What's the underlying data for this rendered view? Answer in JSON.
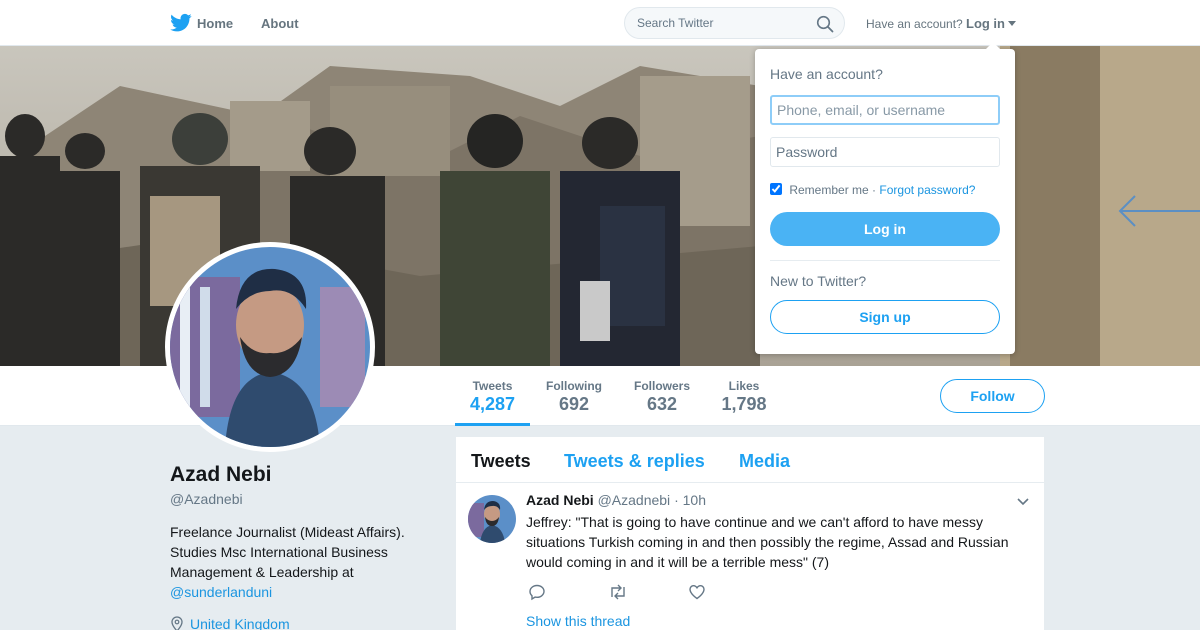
{
  "nav": {
    "home": "Home",
    "about": "About",
    "search_placeholder": "Search Twitter",
    "have_account": "Have an account?",
    "login": "Log in"
  },
  "profile": {
    "name": "Azad Nebi",
    "handle": "@Azadnebi",
    "bio_text": "Freelance Journalist (Mideast Affairs). Studies Msc International Business Management & Leadership at",
    "bio_link": "@sunderlanduni",
    "location": "United Kingdom"
  },
  "stats": [
    {
      "label": "Tweets",
      "value": "4,287"
    },
    {
      "label": "Following",
      "value": "692"
    },
    {
      "label": "Followers",
      "value": "632"
    },
    {
      "label": "Likes",
      "value": "1,798"
    }
  ],
  "follow_label": "Follow",
  "timeline": {
    "tabs": [
      "Tweets",
      "Tweets & replies",
      "Media"
    ],
    "tweet": {
      "name": "Azad Nebi",
      "handle": "@Azadnebi",
      "dot": "·",
      "time": "10h",
      "text": "Jeffrey: \"That is going to have continue and we can't afford to have messy situations Turkish coming in and then possibly the regime, Assad and Russian would coming in and it will be a terrible mess\" (7)",
      "show_thread": "Show this thread"
    }
  },
  "login_dropdown": {
    "title": "Have an account?",
    "username_placeholder": "Phone, email, or username",
    "password_placeholder": "Password",
    "remember_me": "Remember me",
    "separator": "·",
    "forgot_password": "Forgot password?",
    "login_button": "Log in",
    "new_to_twitter": "New to Twitter?",
    "signup_button": "Sign up"
  },
  "colors": {
    "brand": "#1da1f2",
    "link": "#1b95e0",
    "background": "#e6ecf0",
    "secondary_text": "#657786"
  },
  "icons": [
    "twitter-bird-icon",
    "search-icon",
    "caret-down-icon",
    "location-pin-icon",
    "chevron-down-icon",
    "reply-icon",
    "retweet-icon",
    "like-icon"
  ]
}
